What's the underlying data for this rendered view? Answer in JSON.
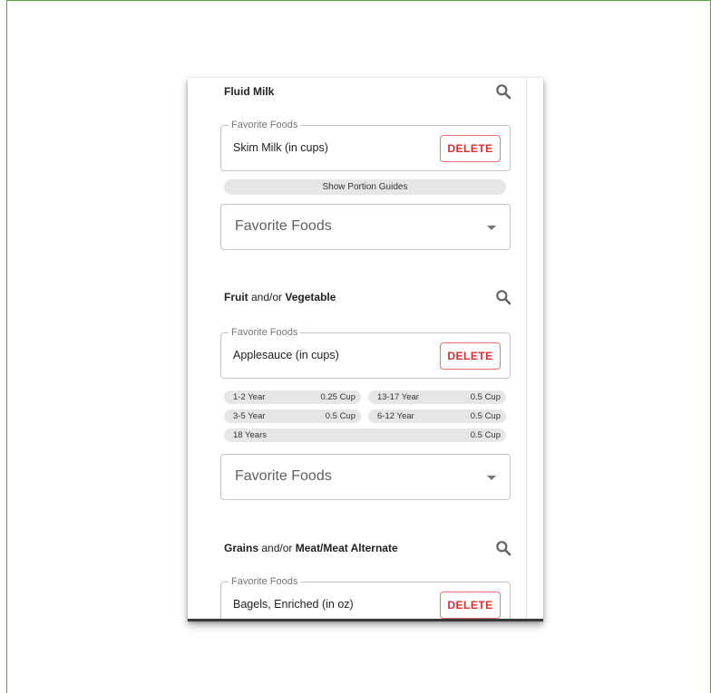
{
  "sections": {
    "milk": {
      "title_bold": "Fluid Milk",
      "favorite": {
        "legend": "Favorite Foods",
        "value": "Skim Milk (in cups)",
        "delete_label": "DELETE"
      },
      "portion_button_label": "Show Portion Guides",
      "select_label": "Favorite Foods"
    },
    "fruit": {
      "title_bold_1": "Fruit",
      "title_connector": " and/or ",
      "title_bold_2": "Vegetable",
      "favorite": {
        "legend": "Favorite Foods",
        "value": "Applesauce (in cups)",
        "delete_label": "DELETE"
      },
      "portions": [
        {
          "age": "1-2 Year",
          "amount": "0.25 Cup"
        },
        {
          "age": "13-17 Year",
          "amount": "0.5 Cup"
        },
        {
          "age": "3-5 Year",
          "amount": "0.5 Cup"
        },
        {
          "age": "6-12 Year",
          "amount": "0.5 Cup"
        },
        {
          "age": "18 Years",
          "amount": "0.5 Cup"
        }
      ],
      "select_label": "Favorite Foods"
    },
    "grains": {
      "title_bold_1": "Grains",
      "title_connector": " and/or ",
      "title_bold_2": "Meat/Meat Alternate",
      "favorite": {
        "legend": "Favorite Foods",
        "value": "Bagels, Enriched (in oz)",
        "delete_label": "DELETE"
      }
    }
  },
  "icons": {
    "search": "search-icon",
    "dropdown": "arrow-drop-down-icon"
  },
  "colors": {
    "accent_red": "#d32f2f",
    "frame_green": "#5da33b",
    "chip_bg": "#e6e6e6"
  }
}
